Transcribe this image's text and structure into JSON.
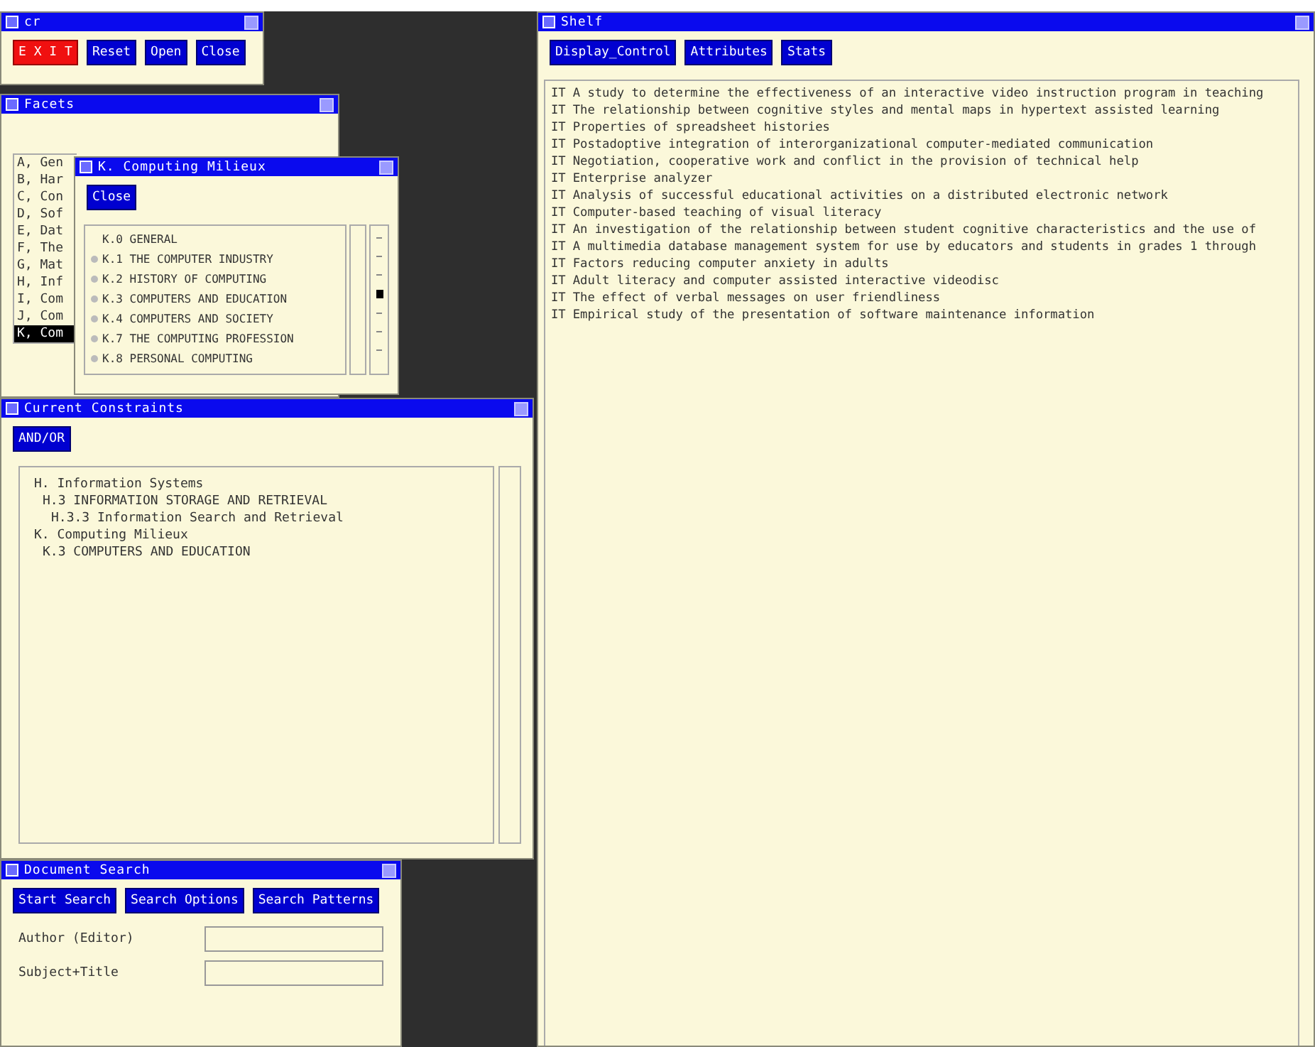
{
  "cr_window": {
    "title": "cr",
    "buttons": [
      {
        "label": "E X I T",
        "kind": "danger"
      },
      {
        "label": "Reset",
        "kind": "normal"
      },
      {
        "label": "Open",
        "kind": "normal"
      },
      {
        "label": "Close",
        "kind": "normal"
      }
    ]
  },
  "facets_window": {
    "title": "Facets",
    "items": [
      {
        "label": "A, Gen",
        "selected": false
      },
      {
        "label": "B, Har",
        "selected": false
      },
      {
        "label": "C, Con",
        "selected": false
      },
      {
        "label": "D, Sof",
        "selected": false
      },
      {
        "label": "E, Dat",
        "selected": false
      },
      {
        "label": "F, The",
        "selected": false
      },
      {
        "label": "G, Mat",
        "selected": false
      },
      {
        "label": "H, Inf",
        "selected": false
      },
      {
        "label": "I, Com",
        "selected": false
      },
      {
        "label": "J, Com",
        "selected": false
      },
      {
        "label": "K, Com",
        "selected": true
      }
    ]
  },
  "milieux_window": {
    "title": "K. Computing Milieux",
    "close_button": "Close",
    "items": [
      {
        "label": "K.0 GENERAL",
        "expandable": false,
        "selected": false
      },
      {
        "label": "K.1 THE COMPUTER INDUSTRY",
        "expandable": true,
        "selected": false
      },
      {
        "label": "K.2 HISTORY OF COMPUTING",
        "expandable": true,
        "selected": false
      },
      {
        "label": "K.3 COMPUTERS AND EDUCATION",
        "expandable": true,
        "selected": true
      },
      {
        "label": "K.4 COMPUTERS AND SOCIETY",
        "expandable": true,
        "selected": false
      },
      {
        "label": "K.7 THE COMPUTING PROFESSION",
        "expandable": true,
        "selected": false
      },
      {
        "label": "K.8 PERSONAL COMPUTING",
        "expandable": true,
        "selected": false
      }
    ]
  },
  "constraints_window": {
    "title": "Current Constraints",
    "button": "AND/OR",
    "tree": [
      {
        "label": "H. Information Systems",
        "children": [
          {
            "label": "H.3 INFORMATION STORAGE AND RETRIEVAL",
            "children": [
              {
                "label": "H.3.3 Information Search and Retrieval"
              }
            ]
          }
        ]
      },
      {
        "label": "K. Computing Milieux",
        "children": [
          {
            "label": "K.3 COMPUTERS AND EDUCATION"
          }
        ]
      }
    ]
  },
  "search_window": {
    "title": "Document Search",
    "buttons": [
      "Start Search",
      "Search Options",
      "Search Patterns"
    ],
    "fields": [
      {
        "label": "Author (Editor)"
      },
      {
        "label": "Subject+Title"
      }
    ]
  },
  "shelf_window": {
    "title": "Shelf",
    "buttons": [
      "Display_Control",
      "Attributes",
      "Stats"
    ],
    "rows": [
      {
        "tag": "IT",
        "title": "A study to determine the effectiveness of an interactive video instruction program in teaching"
      },
      {
        "tag": "IT",
        "title": "The relationship between cognitive styles and mental maps in hypertext assisted learning"
      },
      {
        "tag": "IT",
        "title": "Properties of spreadsheet histories"
      },
      {
        "tag": "IT",
        "title": "Postadoptive integration of interorganizational computer-mediated communication"
      },
      {
        "tag": "IT",
        "title": "Negotiation, cooperative work and conflict in the provision of technical help"
      },
      {
        "tag": "IT",
        "title": "Enterprise analyzer"
      },
      {
        "tag": "IT",
        "title": "Analysis of successful educational activities on a distributed electronic network"
      },
      {
        "tag": "IT",
        "title": "Computer-based teaching of visual literacy"
      },
      {
        "tag": "IT",
        "title": "An investigation of the relationship between student cognitive characteristics and the use of"
      },
      {
        "tag": "IT",
        "title": "A multimedia database management system for use by educators and students in grades 1 through"
      },
      {
        "tag": "IT",
        "title": "Factors reducing computer anxiety in adults"
      },
      {
        "tag": "IT",
        "title": "Adult literacy and computer assisted interactive videodisc"
      },
      {
        "tag": "IT",
        "title": "The effect of verbal messages on user friendliness"
      },
      {
        "tag": "IT",
        "title": "Empirical study of the presentation of software maintenance information"
      }
    ]
  }
}
